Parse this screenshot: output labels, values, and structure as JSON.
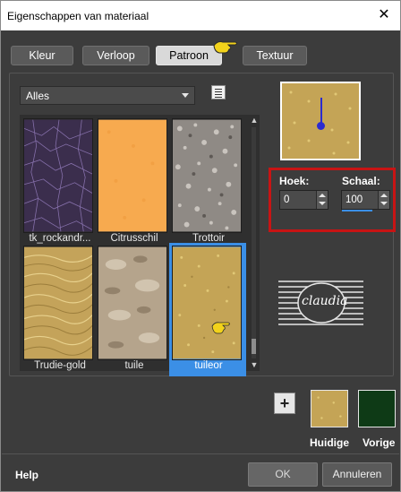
{
  "window": {
    "title": "Eigenschappen van materiaal",
    "close_glyph": "✕"
  },
  "tabs": [
    {
      "label": "Kleur",
      "active": false
    },
    {
      "label": "Verloop",
      "active": false
    },
    {
      "label": "Patroon",
      "active": true
    },
    {
      "label": "Textuur",
      "active": false
    }
  ],
  "category_dropdown": {
    "selected": "Alles",
    "icon": "chevron-down-icon"
  },
  "view_toggle": {
    "icon": "list-view-icon"
  },
  "patterns": [
    {
      "label": "tk_rockandr...",
      "selected": false,
      "color": "#4a3a5e"
    },
    {
      "label": "Citrusschil",
      "selected": false,
      "color": "#f7a84d"
    },
    {
      "label": "Trottoir",
      "selected": false,
      "color": "#9a9590"
    },
    {
      "label": "Trudie-gold",
      "selected": false,
      "color": "#c9a85a"
    },
    {
      "label": "tuile",
      "selected": false,
      "color": "#b9a88e"
    },
    {
      "label": "tuileor",
      "selected": true,
      "color": "#c4a456"
    }
  ],
  "angle": {
    "label": "Hoek:",
    "value": "0"
  },
  "scale": {
    "label": "Schaal:",
    "value": "100"
  },
  "logo": {
    "text": "claudia"
  },
  "add_button": {
    "glyph": "+"
  },
  "current_swatch": {
    "label": "Huidige",
    "color": "#c4a456"
  },
  "previous_swatch": {
    "label": "Vorige",
    "color": "#0e3a16"
  },
  "footer": {
    "help_label": "Help",
    "ok_label": "OK",
    "cancel_label": "Annuleren"
  }
}
